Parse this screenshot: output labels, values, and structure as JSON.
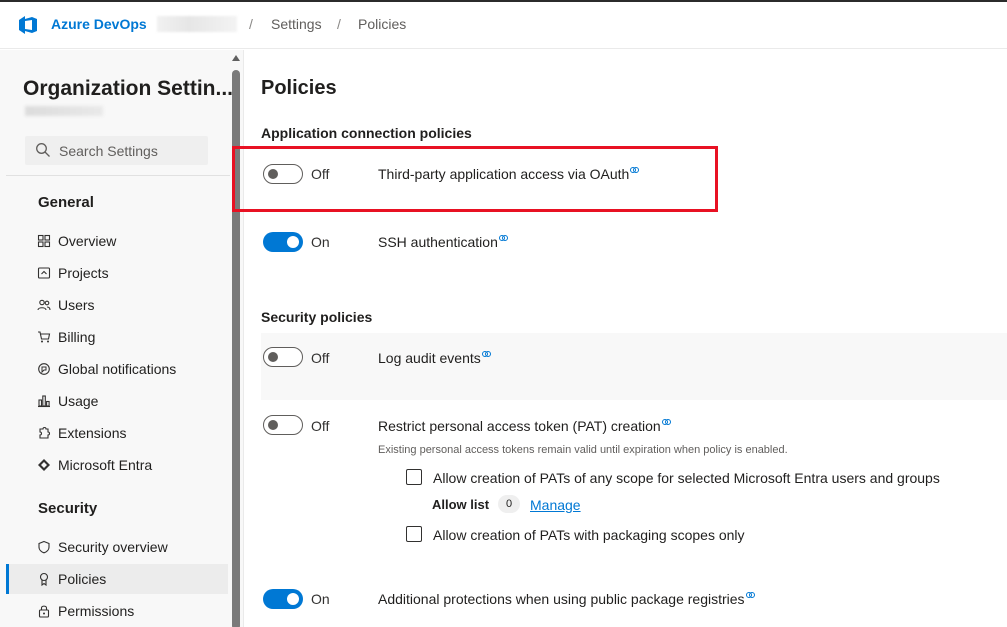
{
  "header": {
    "brand": "Azure DevOps",
    "breadcrumbs": [
      "Settings",
      "Policies"
    ],
    "separator": "/"
  },
  "sidebar": {
    "title": "Organization Settin...",
    "search_placeholder": "Search Settings",
    "groups": [
      {
        "title": "General",
        "items": [
          {
            "label": "Overview",
            "icon": "overview-icon"
          },
          {
            "label": "Projects",
            "icon": "projects-icon"
          },
          {
            "label": "Users",
            "icon": "users-icon"
          },
          {
            "label": "Billing",
            "icon": "billing-icon"
          },
          {
            "label": "Global notifications",
            "icon": "notifications-icon"
          },
          {
            "label": "Usage",
            "icon": "usage-icon"
          },
          {
            "label": "Extensions",
            "icon": "extensions-icon"
          },
          {
            "label": "Microsoft Entra",
            "icon": "entra-icon"
          }
        ]
      },
      {
        "title": "Security",
        "items": [
          {
            "label": "Security overview",
            "icon": "shield-icon"
          },
          {
            "label": "Policies",
            "icon": "policy-icon",
            "selected": true
          },
          {
            "label": "Permissions",
            "icon": "lock-icon"
          }
        ]
      }
    ]
  },
  "main": {
    "title": "Policies",
    "sections": [
      {
        "title": "Application connection policies",
        "policies": [
          {
            "state": "Off",
            "on": false,
            "label": "Third-party application access via OAuth",
            "highlighted": true
          },
          {
            "state": "On",
            "on": true,
            "label": "SSH authentication"
          }
        ]
      },
      {
        "title": "Security policies",
        "policies": [
          {
            "state": "Off",
            "on": false,
            "label": "Log audit events"
          },
          {
            "state": "Off",
            "on": false,
            "label": "Restrict personal access token (PAT) creation",
            "description": "Existing personal access tokens remain valid until expiration when policy is enabled.",
            "options": {
              "any_scope_label": "Allow creation of PATs of any scope for selected Microsoft Entra users and groups",
              "allow_list_label": "Allow list",
              "allow_list_count": "0",
              "manage_label": "Manage",
              "packaging_label": "Allow creation of PATs with packaging scopes only"
            }
          },
          {
            "state": "On",
            "on": true,
            "label": "Additional protections when using public package registries"
          }
        ]
      }
    ]
  },
  "colors": {
    "accent": "#0078d4",
    "highlight": "#e81123",
    "toggle_off": "#605e5c"
  }
}
